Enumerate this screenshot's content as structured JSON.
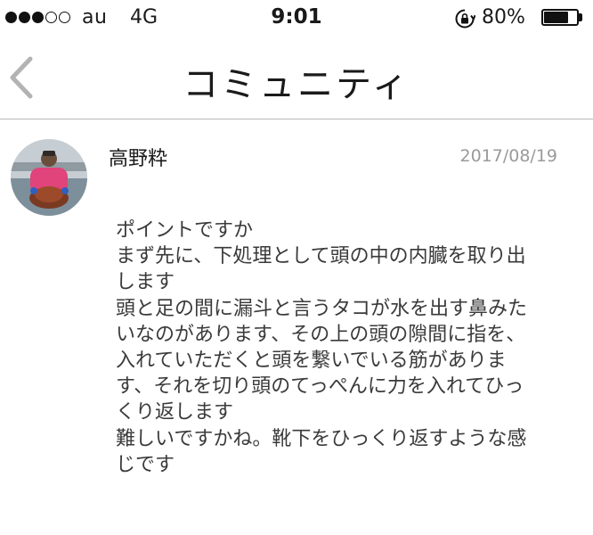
{
  "status_bar": {
    "signal_strength": 3,
    "signal_max": 5,
    "carrier": "au",
    "network": "4G",
    "time": "9:01",
    "battery_percent": "80%",
    "battery_level": 0.8
  },
  "nav": {
    "back_icon": "chevron-left-icon",
    "title": "コミュニティ"
  },
  "post": {
    "author": "高野粋",
    "date": "2017/08/19",
    "body_lines": [
      "ポイントですか",
      "まず先に、下処理として頭の中の内臓を取り出",
      "します",
      "頭と足の間に漏斗と言うタコが水を出す鼻みた",
      "いなのがあります、その上の頭の隙間に指を、",
      "入れていただくと頭を繋いでいる筋がありま",
      "す、それを切り頭のてっぺんに力を入れてひっ",
      "くり返します",
      "難しいですかね。靴下をひっくり返すような感",
      "じです"
    ]
  }
}
